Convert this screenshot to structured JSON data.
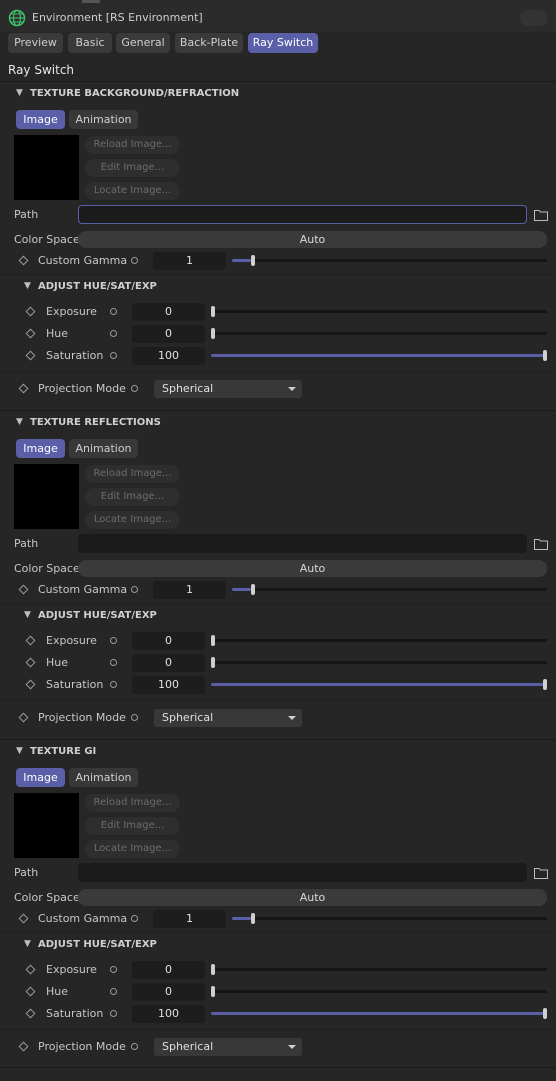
{
  "window": {
    "title": "Environment [RS Environment]"
  },
  "tabs": [
    {
      "label": "Preview"
    },
    {
      "label": "Basic"
    },
    {
      "label": "General"
    },
    {
      "label": "Back-Plate"
    },
    {
      "label": "Ray Switch"
    }
  ],
  "active_tab": "Ray Switch",
  "page_heading": "Ray Switch",
  "sections": [
    {
      "title": "TEXTURE BACKGROUND/REFRACTION",
      "subtabs": [
        "Image",
        "Animation"
      ],
      "image_buttons": [
        "Reload Image...",
        "Edit Image...",
        "Locate Image..."
      ],
      "path_label": "Path",
      "path_value": "",
      "color_space_label": "Color Space",
      "color_space_value": "Auto",
      "custom_gamma_label": "Custom Gamma",
      "custom_gamma_value": "1",
      "custom_gamma_fraction": 0.06,
      "adjust_title": "ADJUST HUE/SAT/EXP",
      "exposure_label": "Exposure",
      "exposure_value": "0",
      "hue_label": "Hue",
      "hue_value": "0",
      "saturation_label": "Saturation",
      "saturation_value": "100",
      "saturation_fraction": 1.0,
      "projection_label": "Projection Mode",
      "projection_value": "Spherical"
    },
    {
      "title": "TEXTURE REFLECTIONS",
      "subtabs": [
        "Image",
        "Animation"
      ],
      "image_buttons": [
        "Reload Image...",
        "Edit Image...",
        "Locate Image..."
      ],
      "path_label": "Path",
      "path_value": "",
      "color_space_label": "Color Space",
      "color_space_value": "Auto",
      "custom_gamma_label": "Custom Gamma",
      "custom_gamma_value": "1",
      "custom_gamma_fraction": 0.06,
      "adjust_title": "ADJUST HUE/SAT/EXP",
      "exposure_label": "Exposure",
      "exposure_value": "0",
      "hue_label": "Hue",
      "hue_value": "0",
      "saturation_label": "Saturation",
      "saturation_value": "100",
      "saturation_fraction": 1.0,
      "projection_label": "Projection Mode",
      "projection_value": "Spherical"
    },
    {
      "title": "TEXTURE GI",
      "subtabs": [
        "Image",
        "Animation"
      ],
      "image_buttons": [
        "Reload Image...",
        "Edit Image...",
        "Locate Image..."
      ],
      "path_label": "Path",
      "path_value": "",
      "color_space_label": "Color Space",
      "color_space_value": "Auto",
      "custom_gamma_label": "Custom Gamma",
      "custom_gamma_value": "1",
      "custom_gamma_fraction": 0.06,
      "adjust_title": "ADJUST HUE/SAT/EXP",
      "exposure_label": "Exposure",
      "exposure_value": "0",
      "hue_label": "Hue",
      "hue_value": "0",
      "saturation_label": "Saturation",
      "saturation_value": "100",
      "saturation_fraction": 1.0,
      "projection_label": "Projection Mode",
      "projection_value": "Spherical"
    }
  ],
  "colors": {
    "accent": "#5a5fa8",
    "background": "#262626",
    "field": "#1d1d1d",
    "globe": "#3fbf6a"
  },
  "icons": [
    "globe-icon",
    "folder-icon",
    "chevron-down-icon",
    "keyframe-diamond-icon",
    "animation-circle-icon",
    "dropdown-arrow-icon"
  ]
}
